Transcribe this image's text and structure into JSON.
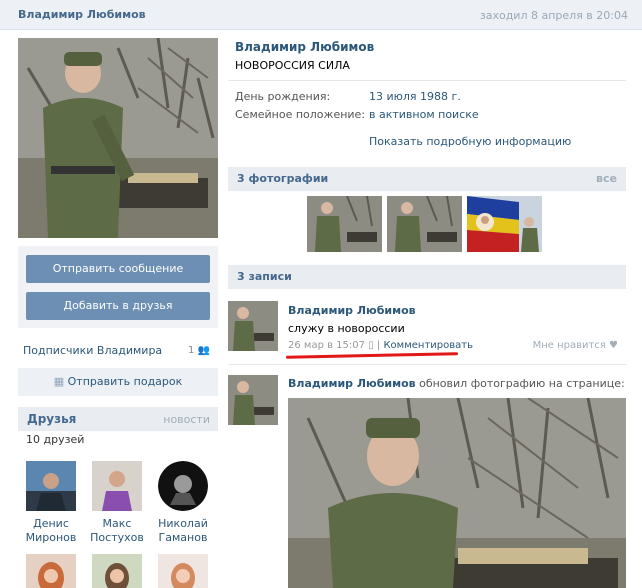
{
  "header": {
    "name": "Владимир Любимов",
    "last_seen": "заходил 8 апреля в 20:04"
  },
  "actions": {
    "message": "Отправить сообщение",
    "add_friend": "Добавить в друзья",
    "subscribers": "Подписчики Владимира",
    "subscribers_count": "1",
    "gift": "Отправить подарок"
  },
  "friends": {
    "title": "Друзья",
    "news": "новости",
    "count": "10 друзей",
    "items": [
      {
        "first": "Денис",
        "last": "Миронов"
      },
      {
        "first": "Макс",
        "last": "Постухов"
      },
      {
        "first": "Николай",
        "last": "Гаманов"
      }
    ]
  },
  "profile": {
    "name": "Владимир Любимов",
    "status": "НОВОРОССИЯ СИЛА",
    "birthday_label": "День рождения:",
    "birthday_value": "13 июля 1988 г.",
    "family_label": "Семейное положение:",
    "family_value": "в активном поиске",
    "show_more": "Показать подробную информацию"
  },
  "photos": {
    "title": "3 фотографии",
    "all": "все"
  },
  "posts": {
    "title": "3 записи",
    "first": {
      "author": "Владимир Любимов",
      "text": "служу в новороссии",
      "date": "26 мар в 15:07",
      "separator": "|",
      "comment": "Комментировать",
      "like": "Мне нравится"
    },
    "second": {
      "author": "Владимир Любимов",
      "action": "обновил фотографию на странице:"
    }
  },
  "colors": {
    "link": "#2b587a",
    "header_link": "#45688e",
    "button": "#6d8fb3",
    "highlight_underline": "#e01818"
  }
}
